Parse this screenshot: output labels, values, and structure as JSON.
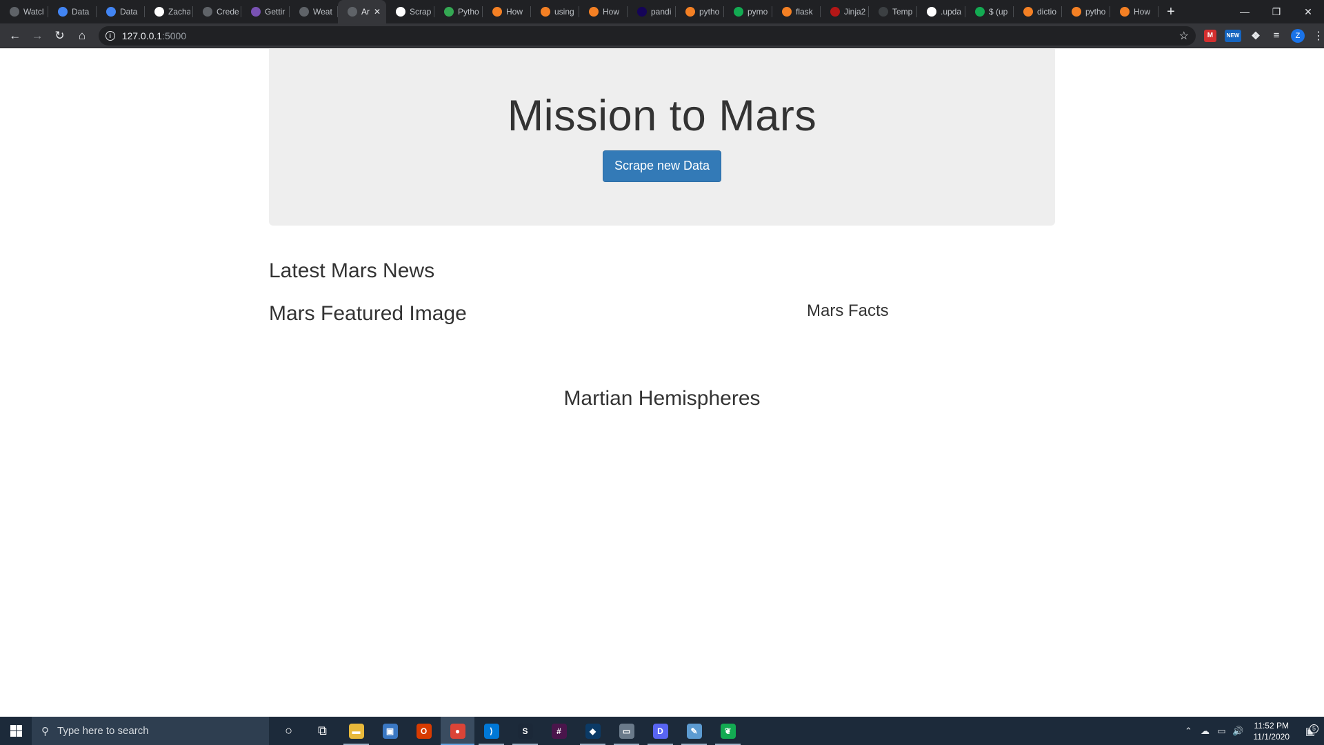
{
  "browser": {
    "tabs": [
      {
        "title": "Watcl",
        "icon": "globe-icon",
        "color": "#5f6368"
      },
      {
        "title": "Data",
        "icon": "docs-icon",
        "color": "#4285f4"
      },
      {
        "title": "Data",
        "icon": "docs-icon",
        "color": "#4285f4"
      },
      {
        "title": "Zacha",
        "icon": "github-icon",
        "color": "#ffffff"
      },
      {
        "title": "Crede",
        "icon": "globe-icon",
        "color": "#5f6368"
      },
      {
        "title": "Gettir",
        "icon": "bootstrap-icon",
        "color": "#7952b3"
      },
      {
        "title": "Weat",
        "icon": "globe-icon",
        "color": "#5f6368"
      },
      {
        "title": "Ar",
        "icon": "globe-icon",
        "color": "#5f6368",
        "active": true
      },
      {
        "title": "Scrap",
        "icon": "check-circle-icon",
        "color": "#ffffff"
      },
      {
        "title": "Pytho",
        "icon": "flag-icon",
        "color": "#34a853"
      },
      {
        "title": "How",
        "icon": "stackoverflow-icon",
        "color": "#f48024"
      },
      {
        "title": "using",
        "icon": "stackoverflow-icon",
        "color": "#f48024"
      },
      {
        "title": "How",
        "icon": "stackoverflow-icon",
        "color": "#f48024"
      },
      {
        "title": "pandi",
        "icon": "pandas-icon",
        "color": "#150458"
      },
      {
        "title": "pytho",
        "icon": "stackoverflow-icon",
        "color": "#f48024"
      },
      {
        "title": "pymo",
        "icon": "mongodb-leaf-icon",
        "color": "#13aa52"
      },
      {
        "title": "flask",
        "icon": "stackoverflow-icon",
        "color": "#f48024"
      },
      {
        "title": "Jinja2",
        "icon": "jinja-icon",
        "color": "#b41717"
      },
      {
        "title": "Temp",
        "icon": "page-icon",
        "color": "#3c4043"
      },
      {
        "title": ".upda",
        "icon": "google-icon",
        "color": "#ffffff"
      },
      {
        "title": "$ (up",
        "icon": "mongodb-leaf-icon",
        "color": "#13aa52"
      },
      {
        "title": "dictio",
        "icon": "stackoverflow-icon",
        "color": "#f48024"
      },
      {
        "title": "pytho",
        "icon": "stackoverflow-icon",
        "color": "#f48024"
      },
      {
        "title": "How",
        "icon": "stackoverflow-icon",
        "color": "#f48024"
      }
    ],
    "new_tab_label": "+",
    "url_host": "127.0.0.1",
    "url_port": ":5000",
    "profile_initial": "Z",
    "ext_badge": "NEW"
  },
  "page": {
    "title": "Mission to Mars",
    "scrape_button": "Scrape new Data",
    "news_heading": "Latest Mars News",
    "featured_image_heading": "Mars Featured Image",
    "facts_heading": "Mars Facts",
    "hemispheres_heading": "Martian Hemispheres"
  },
  "taskbar": {
    "search_placeholder": "Type here to search",
    "apps": [
      {
        "name": "cortana-icon",
        "glyph": "○",
        "color": "transparent"
      },
      {
        "name": "task-view-icon",
        "glyph": "⧉",
        "color": "transparent"
      },
      {
        "name": "file-explorer-icon",
        "glyph": "▬",
        "color": "#e8b93b",
        "running": true
      },
      {
        "name": "store-icon",
        "glyph": "▣",
        "color": "#3a78c3"
      },
      {
        "name": "office-icon",
        "glyph": "O",
        "color": "#d83b01"
      },
      {
        "name": "chrome-icon",
        "glyph": "●",
        "color": "#db4437",
        "running": true,
        "active": true
      },
      {
        "name": "vscode-icon",
        "glyph": "⟩",
        "color": "#0078d7",
        "running": true
      },
      {
        "name": "steam-icon",
        "glyph": "S",
        "color": "#1b2838",
        "running": true
      },
      {
        "name": "slack-icon",
        "glyph": "#",
        "color": "#4a154b"
      },
      {
        "name": "app-icon",
        "glyph": "◆",
        "color": "#0b3a66",
        "running": true
      },
      {
        "name": "terminal-icon",
        "glyph": "▭",
        "color": "#6a7a8a",
        "running": true
      },
      {
        "name": "discord-icon",
        "glyph": "D",
        "color": "#5865f2",
        "running": true
      },
      {
        "name": "paint-icon",
        "glyph": "✎",
        "color": "#5c9bd1",
        "running": true
      },
      {
        "name": "mongodb-compass-icon",
        "glyph": "❦",
        "color": "#13aa52",
        "running": true
      }
    ],
    "time": "11:52 PM",
    "date": "11/1/2020",
    "notification_count": "5"
  }
}
